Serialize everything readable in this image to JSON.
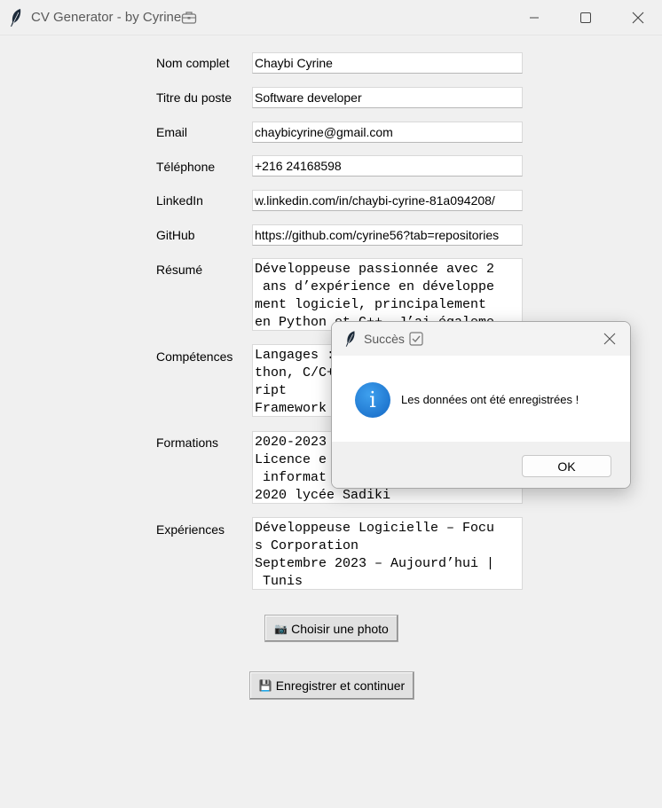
{
  "window": {
    "title": "CV Generator - by Cyrine"
  },
  "form": {
    "fields": [
      {
        "label": "Nom complet",
        "value": "Chaybi Cyrine"
      },
      {
        "label": "Titre du poste",
        "value": "Software developer"
      },
      {
        "label": "Email",
        "value": "chaybicyrine@gmail.com"
      },
      {
        "label": "Téléphone",
        "value": "+216 24168598"
      },
      {
        "label": "LinkedIn",
        "value": "w.linkedin.com/in/chaybi-cyrine-81a094208/"
      },
      {
        "label": "GitHub",
        "value": "https://github.com/cyrine56?tab=repositories"
      }
    ],
    "areas": [
      {
        "label": "Résumé",
        "value": "Développeuse passionnée avec 2\n ans d’expérience en développe\nment logiciel, principalement\nen Python et C++. J’ai égaleme"
      },
      {
        "label": "Compétences",
        "value": "Langages : \nthon, C/C++\nript\nFramework"
      },
      {
        "label": "Formations",
        "value": "2020-2023\nLicence e\n informat\n2020 lycée Sadiki"
      },
      {
        "label": "Expériences",
        "value": "Développeuse Logicielle – Focu\ns Corporation\nSeptembre 2023 – Aujourd’hui |\n Tunis"
      }
    ],
    "photo_button": {
      "icon": "📷",
      "label": "Choisir une photo"
    },
    "save_button": {
      "icon": "💾",
      "label": "Enregistrer et continuer"
    }
  },
  "dialog": {
    "title": "Succès",
    "message": "Les données ont été enregistrées !",
    "info_glyph": "i",
    "ok_label": "OK"
  }
}
